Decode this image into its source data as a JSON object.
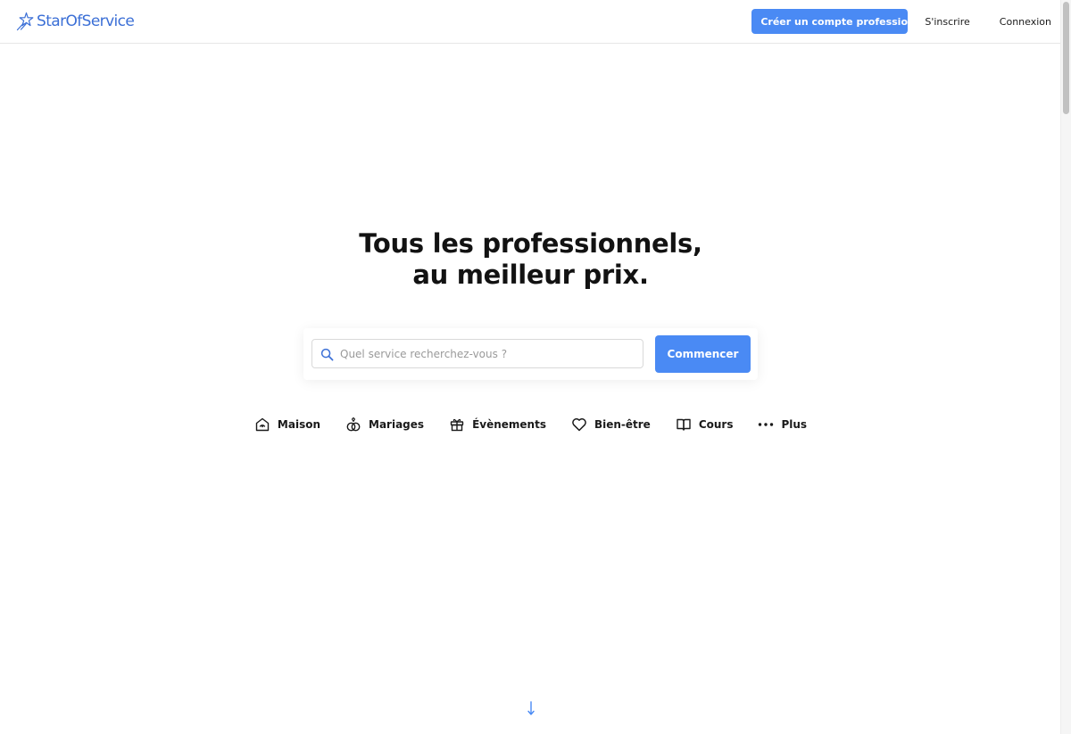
{
  "header": {
    "logo_text": "StarOfService",
    "pro_button_label": "Créer un compte professionnel",
    "signup_label": "S'inscrire",
    "login_label": "Connexion"
  },
  "hero": {
    "title_line1": "Tous les professionnels,",
    "title_line2": "au meilleur prix."
  },
  "search": {
    "placeholder": "Quel service recherchez-vous ?",
    "value": "",
    "submit_label": "Commencer"
  },
  "categories": [
    {
      "label": "Maison",
      "icon": "house-icon"
    },
    {
      "label": "Mariages",
      "icon": "rings-icon"
    },
    {
      "label": "Évènements",
      "icon": "gift-icon"
    },
    {
      "label": "Bien-être",
      "icon": "heart-icon"
    },
    {
      "label": "Cours",
      "icon": "book-icon"
    },
    {
      "label": "Plus",
      "icon": "more-dots-icon"
    }
  ],
  "colors": {
    "brand": "#4a8af4",
    "logo": "#3b6fd6",
    "text": "#1a1a1a",
    "arrow": "#4a8af4"
  }
}
